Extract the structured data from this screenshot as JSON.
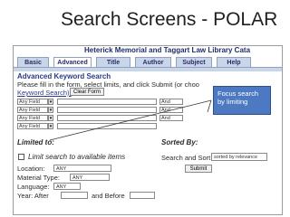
{
  "slide": {
    "title": "Search Screens - POLAR"
  },
  "library": {
    "banner": "Heterick Memorial and Taggart Law Library Cata"
  },
  "tabs": [
    "Basic",
    "Advanced",
    "Title",
    "Author",
    "Subject",
    "Help"
  ],
  "form": {
    "heading": "Advanced Keyword Search",
    "instructions": "Please fill in the form, select limits, and click Submit (or choo",
    "keyword_link": "Keyword Search).",
    "clear_button": "Clear Form",
    "rows": [
      {
        "field": "Any Field",
        "operator": "And"
      },
      {
        "field": "Any Field",
        "operator": "And"
      },
      {
        "field": "Any Field",
        "operator": "And"
      },
      {
        "field": "Any Field",
        "operator": ""
      }
    ]
  },
  "callout": {
    "text": "Focus search by limiting"
  },
  "limits": {
    "heading": "Limited to:",
    "checkbox_label": "Limit search to available items",
    "location_label": "Location:",
    "location_value": "ANY",
    "material_label": "Material Type:",
    "material_value": "ANY",
    "language_label": "Language:",
    "language_value": "ANY",
    "year_label": "Year: After",
    "year_before": "and Before"
  },
  "sorting": {
    "heading": "Sorted By:",
    "label": "Search and Sort:",
    "value": "sorted by relevance",
    "submit": "Submit"
  },
  "colors": {
    "tab_bg": "#c9d5e8",
    "heading": "#2b3a8a",
    "callout_bg": "#4d79c2"
  }
}
